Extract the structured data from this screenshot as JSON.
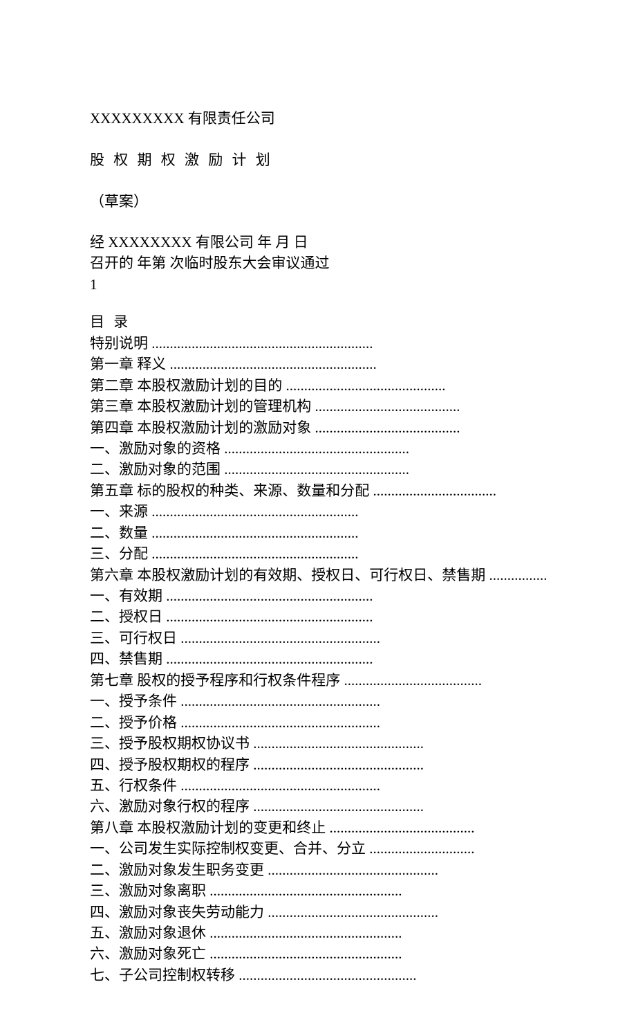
{
  "header": {
    "company": "XXXXXXXXX 有限责任公司",
    "plan_title": "股 权 期 权 激 励 计 划",
    "draft_label": "（草案）",
    "intro_line1": "经 XXXXXXXX 有限公司       年    月     日",
    "intro_line2": "召开的       年第     次临时股东大会审议通过",
    "page_number": "1"
  },
  "toc": {
    "title": "目 录",
    "entries": [
      {
        "text": "特别说明 ",
        "dots": "............................................................."
      },
      {
        "text": "第一章  释义 ",
        "dots": "........................................................."
      },
      {
        "text": "第二章  本股权激励计划的目的 ",
        "dots": "............................................"
      },
      {
        "text": "第三章  本股权激励计划的管理机构 ",
        "dots": "........................................"
      },
      {
        "text": "第四章  本股权激励计划的激励对象 ",
        "dots": "........................................"
      },
      {
        "text": "一、激励对象的资格 ",
        "dots": "..................................................."
      },
      {
        "text": "二、激励对象的范围 ",
        "dots": "..................................................."
      },
      {
        "text": "第五章  标的股权的种类、来源、数量和分配 ",
        "dots": ".................................."
      },
      {
        "text": "一、来源 ",
        "dots": "........................................................."
      },
      {
        "text": "二、数量 ",
        "dots": "........................................................."
      },
      {
        "text": "三、分配 ",
        "dots": "........................................................."
      },
      {
        "text": "第六章  本股权激励计划的有效期、授权日、可行权日、禁售期 ",
        "dots": ".................."
      },
      {
        "text": "一、有效期 ",
        "dots": "........................................................."
      },
      {
        "text": "二、授权日 ",
        "dots": "........................................................."
      },
      {
        "text": "三、可行权日 ",
        "dots": "......................................................."
      },
      {
        "text": "四、禁售期 ",
        "dots": "........................................................."
      },
      {
        "text": "第七章  股权的授予程序和行权条件程序 ",
        "dots": "......................................"
      },
      {
        "text": "一、授予条件 ",
        "dots": "......................................................."
      },
      {
        "text": "二、授予价格 ",
        "dots": "......................................................."
      },
      {
        "text": "三、授予股权期权协议书 ",
        "dots": "..............................................."
      },
      {
        "text": "四、授予股权期权的程序 ",
        "dots": "..............................................."
      },
      {
        "text": "五、行权条件 ",
        "dots": "......................................................."
      },
      {
        "text": "六、激励对象行权的程序 ",
        "dots": "..............................................."
      },
      {
        "text": "第八章  本股权激励计划的变更和终止 ",
        "dots": "........................................"
      },
      {
        "text": "一、公司发生实际控制权变更、合并、分立 ",
        "dots": "............................."
      },
      {
        "text": "二、激励对象发生职务变更 ",
        "dots": "..............................................."
      },
      {
        "text": "三、激励对象离职 ",
        "dots": "....................................................."
      },
      {
        "text": "四、激励对象丧失劳动能力 ",
        "dots": "..............................................."
      },
      {
        "text": "五、激励对象退休 ",
        "dots": "....................................................."
      },
      {
        "text": "六、激励对象死亡 ",
        "dots": "....................................................."
      },
      {
        "text": "七、子公司控制权转移 ",
        "dots": "................................................."
      }
    ]
  }
}
